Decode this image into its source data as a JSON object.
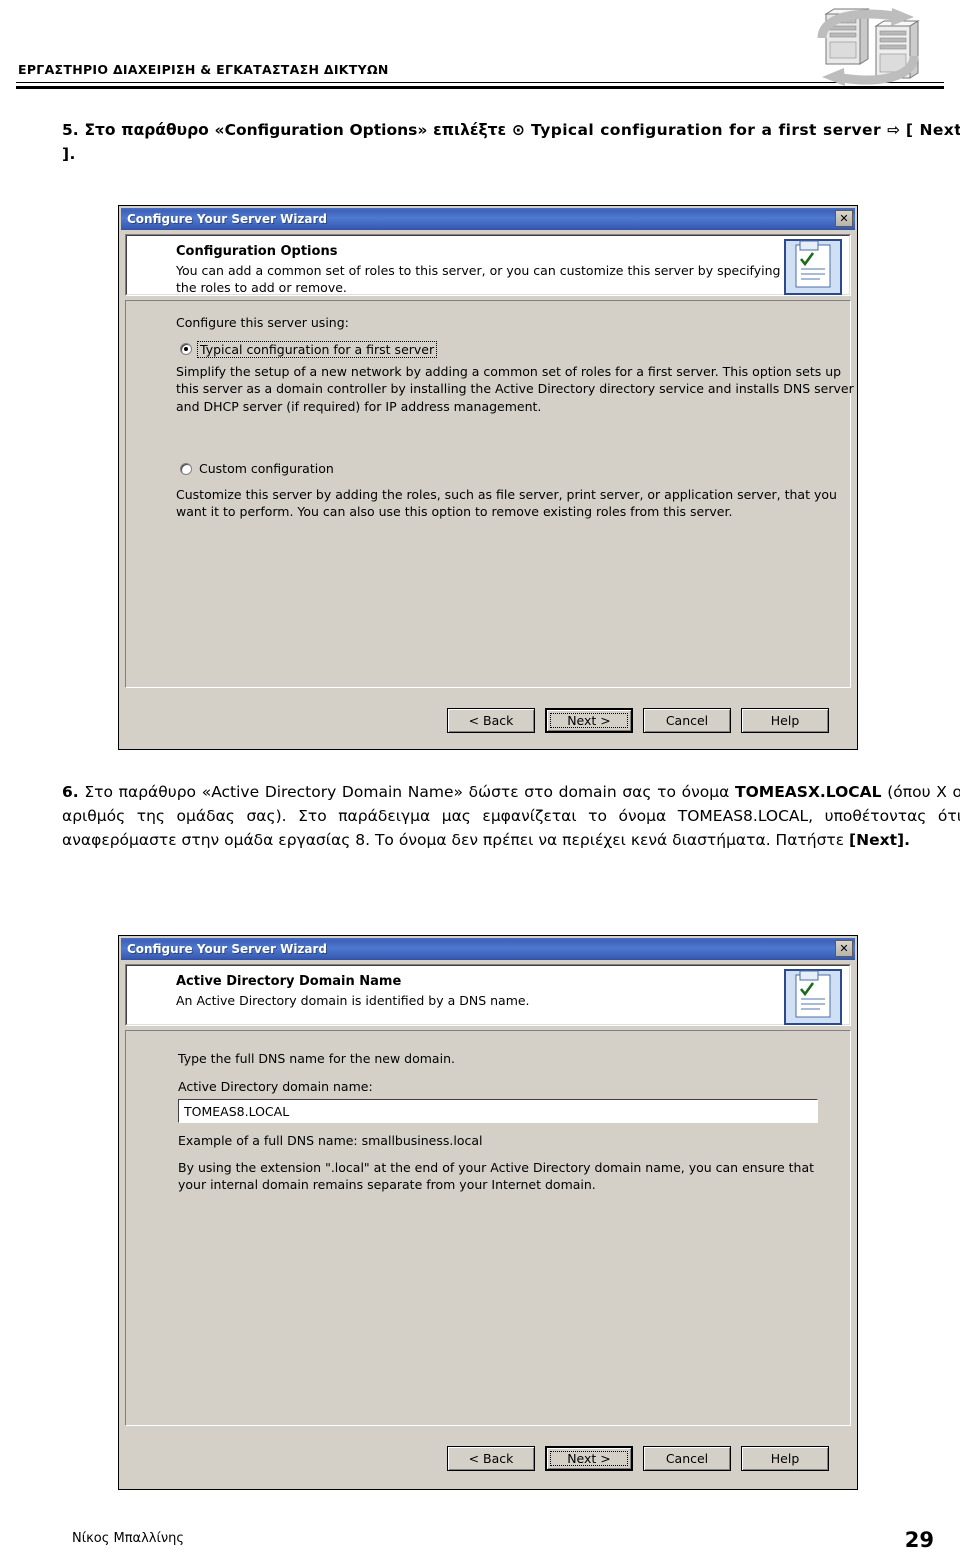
{
  "header": {
    "title": "ΕΡΓΑΣΤΗΡΙΟ ΔΙΑΧΕΙΡΙΣΗ & ΕΓΚΑΤΑΣΤΑΣΗ ΔΙΚΤΥΩΝ",
    "logo_icon": "server-stack-refresh-icon"
  },
  "steps": {
    "step5": {
      "number": "5.",
      "text_before": "Στο παράθυρο «Configuration Options» επιλέξτε ",
      "radio_glyph": "⊙",
      "option": " Typical configuration for a first server ",
      "arrow": "⇨",
      "next": "[ Next ]."
    },
    "step6": {
      "number": "6.",
      "line1": "Στο παράθυρο «Active Directory Domain Name» δώστε στο domain σας το όνομα",
      "domain_bold": "TOMEASX.LOCAL",
      "line2_rest": " (όπου Χ ο αριθμός της ομάδας σας). Στο παράδειγμα μας εμφανίζεται",
      "line3": "το όνομα TOMEAS8.LOCAL, υποθέτοντας ότι αναφερόμαστε στην ομάδα εργασίας 8. Το",
      "line4": "όνομα δεν πρέπει να περιέχει κενά διαστήματα. Πατήστε ",
      "next_bold": "[Next]."
    }
  },
  "dialog1": {
    "title": "Configure Your Server Wizard",
    "close_label": "✕",
    "header": {
      "title": "Configuration Options",
      "subtitle": "You can add a common set of roles to this server, or you can customize this server by specifying the roles to add or remove.",
      "icon": "wizard-checklist-icon"
    },
    "group_label": "Configure this server using:",
    "option1": {
      "label": "Typical configuration for a first server",
      "selected": true,
      "description": "Simplify the setup of a new network by adding a common set of roles for a first server. This option sets up this server as a domain controller by installing the Active Directory directory service and installs DNS server and DHCP server (if required) for IP address management."
    },
    "option2": {
      "label": "Custom configuration",
      "selected": false,
      "description": "Customize this server by adding the roles, such as file server, print server, or application server, that you want it to perform. You can also use this option to remove existing roles from this server."
    },
    "buttons": [
      {
        "label": "< Back",
        "default": false,
        "focused": false
      },
      {
        "label": "Next >",
        "default": true,
        "focused": true
      },
      {
        "label": "Cancel",
        "default": false,
        "focused": false
      },
      {
        "label": "Help",
        "default": false,
        "focused": false
      }
    ]
  },
  "dialog2": {
    "title": "Configure Your Server Wizard",
    "close_label": "✕",
    "header": {
      "title": "Active Directory Domain Name",
      "subtitle": "An Active Directory domain is identified by a DNS name.",
      "icon": "wizard-checklist-icon"
    },
    "instruction": "Type the full DNS name for the new domain.",
    "field_label": "Active Directory domain name:",
    "field_value": "TOMEAS8.LOCAL",
    "example_text": "Example of a full DNS name: smallbusiness.local",
    "note_text": "By using the extension \".local\" at the end of your Active Directory domain name, you can ensure that your internal domain remains separate from your Internet domain.",
    "buttons": [
      {
        "label": "< Back",
        "default": false,
        "focused": false
      },
      {
        "label": "Next >",
        "default": true,
        "focused": true
      },
      {
        "label": "Cancel",
        "default": false,
        "focused": false
      },
      {
        "label": "Help",
        "default": false,
        "focused": false
      }
    ]
  },
  "footer": {
    "author": "Νίκος Μπαλλίνης",
    "page_number": "29"
  }
}
